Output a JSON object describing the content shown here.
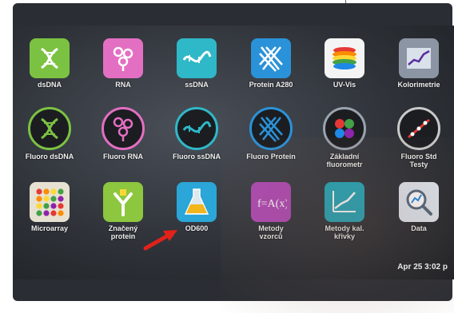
{
  "apps": [
    {
      "id": "dsdna",
      "label": "dsDNA",
      "icon": "dna-helix-icon",
      "bg": "#7cc242",
      "style": "square"
    },
    {
      "id": "rna",
      "label": "RNA",
      "icon": "rna-strand-icon",
      "bg": "#e36fc2",
      "style": "square"
    },
    {
      "id": "ssdna",
      "label": "ssDNA",
      "icon": "single-strand-dna-icon",
      "bg": "#2fb8c8",
      "style": "square"
    },
    {
      "id": "protein-a280",
      "label": "Protein A280",
      "icon": "protein-fibers-icon",
      "bg": "#2a92d9",
      "style": "square"
    },
    {
      "id": "uv-vis",
      "label": "UV-Vis",
      "icon": "rainbow-discs-icon",
      "bg": "#f4f4f4",
      "style": "square"
    },
    {
      "id": "kolorimetrie",
      "label": "Kolorimetrie",
      "icon": "colorimetry-chart-icon",
      "bg": "#8c95a3",
      "style": "square"
    },
    {
      "id": "fluoro-dsdna",
      "label": "Fluoro dsDNA",
      "icon": "dna-helix-icon",
      "ring": "#7cc242",
      "style": "round"
    },
    {
      "id": "fluoro-rna",
      "label": "Fluoro RNA",
      "icon": "rna-strand-icon",
      "ring": "#e36fc2",
      "style": "round"
    },
    {
      "id": "fluoro-ssdna",
      "label": "Fluoro ssDNA",
      "icon": "single-strand-dna-icon",
      "ring": "#2fb8c8",
      "style": "round"
    },
    {
      "id": "fluoro-protein",
      "label": "Fluoro Protein",
      "icon": "protein-fibers-icon",
      "ring": "#2a92d9",
      "style": "round"
    },
    {
      "id": "zakladni-fluorometr",
      "label": "Základní\nfluorometr",
      "icon": "fluorometer-dots-icon",
      "ring": "#9aa3ae",
      "style": "round"
    },
    {
      "id": "fluoro-std-testy",
      "label": "Fluoro Std\nTesty",
      "icon": "standard-curve-icon",
      "ring": "#c9c9c9",
      "style": "round"
    },
    {
      "id": "microarray",
      "label": "Microarray",
      "icon": "microarray-grid-icon",
      "bg": "#e7e1d2",
      "style": "square"
    },
    {
      "id": "znaceny-protein",
      "label": "Značený\nprotein",
      "icon": "antibody-icon",
      "bg": "#8dc63f",
      "style": "square"
    },
    {
      "id": "od600",
      "label": "OD600",
      "icon": "flask-icon",
      "bg": "#2aa6d8",
      "style": "square"
    },
    {
      "id": "metody-vzorcu",
      "label": "Metody\nvzorců",
      "icon": "formula-icon",
      "bg": "#b04ab5",
      "style": "square"
    },
    {
      "id": "metody-kal-krivky",
      "label": "Metody kal.\nkřivky",
      "icon": "calibration-curve-icon",
      "bg": "#22a7b8",
      "style": "square"
    },
    {
      "id": "data",
      "label": "Data",
      "icon": "magnifier-chart-icon",
      "bg": "#dfe6ee",
      "style": "square"
    }
  ],
  "status_bar": {
    "datetime": "Apr 25 3:02 p"
  },
  "annotation": {
    "arrow_icon": "red-arrow-icon",
    "arrow_color": "#e0221b"
  }
}
